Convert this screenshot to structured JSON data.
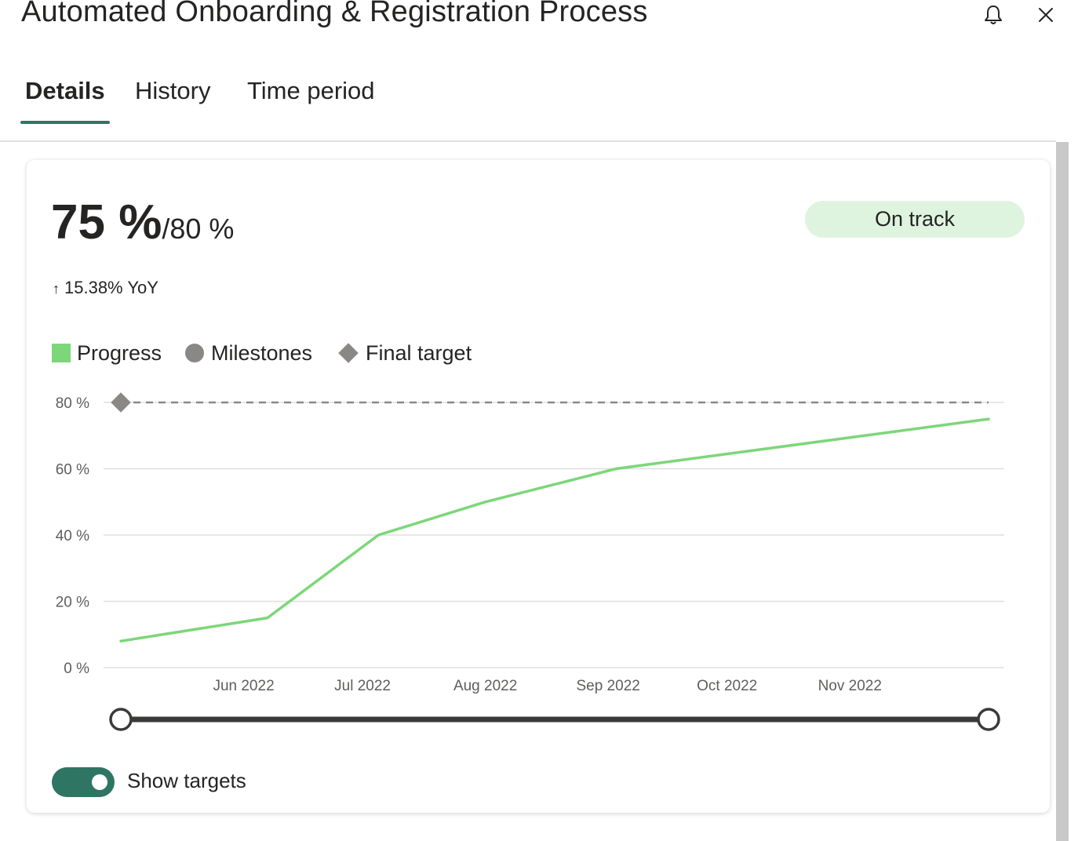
{
  "header": {
    "title": "Automated Onboarding & Registration Process",
    "icons": [
      "bell-icon",
      "close-icon"
    ]
  },
  "tabs": [
    {
      "label": "Details",
      "active": true
    },
    {
      "label": "History",
      "active": false
    },
    {
      "label": "Time period",
      "active": false
    }
  ],
  "summary": {
    "value": "75 %",
    "target": "/80 %",
    "status": "On track",
    "yoy_arrow": "↑",
    "yoy": "15.38% YoY"
  },
  "legend": {
    "progress": "Progress",
    "milestones": "Milestones",
    "final_target": "Final target"
  },
  "chart_data": {
    "type": "line",
    "x_range": [
      "2022-05-01",
      "2022-12-06"
    ],
    "x_ticks": [
      "Jun 2022",
      "Jul 2022",
      "Aug 2022",
      "Sep 2022",
      "Oct 2022",
      "Nov 2022"
    ],
    "y_ticks": [
      "0 %",
      "20 %",
      "40 %",
      "60 %",
      "80 %"
    ],
    "ylim": [
      0,
      80
    ],
    "grid": true,
    "series": [
      {
        "name": "Progress",
        "color": "#7dd67a",
        "x": [
          "2022-05-01",
          "2022-06-07",
          "2022-07-05",
          "2022-08-01",
          "2022-09-03",
          "2022-12-06"
        ],
        "values": [
          8,
          15,
          40,
          50,
          60,
          75
        ]
      }
    ],
    "final_target": {
      "name": "Final target",
      "value": 80,
      "color": "#8a8886"
    }
  },
  "slider": {
    "start": "2022-05-01",
    "end": "2022-12-06"
  },
  "controls": {
    "show_targets_label": "Show targets",
    "show_targets_on": true
  }
}
